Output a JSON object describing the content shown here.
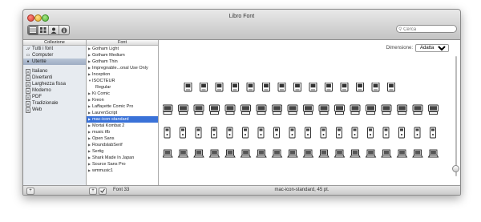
{
  "window": {
    "title": "Libro Font"
  },
  "search": {
    "placeholder": "Cerca"
  },
  "collections": {
    "header": "Collezione",
    "items": [
      {
        "label": "Tutti i font",
        "icon": "font-book-icon",
        "selected": false
      },
      {
        "label": "Computer",
        "icon": "computer-icon",
        "selected": false
      },
      {
        "label": "Utente",
        "icon": "user-icon",
        "selected": true
      },
      {
        "label": "Italiano",
        "icon": "font-collection-icon",
        "selected": false
      },
      {
        "label": "Divertenti",
        "icon": "font-collection-icon",
        "selected": false
      },
      {
        "label": "Larghezza fissa",
        "icon": "font-collection-icon",
        "selected": false
      },
      {
        "label": "Moderno",
        "icon": "font-collection-icon",
        "selected": false
      },
      {
        "label": "PDF",
        "icon": "font-collection-icon",
        "selected": false
      },
      {
        "label": "Tradizionale",
        "icon": "font-collection-icon",
        "selected": false
      },
      {
        "label": "Web",
        "icon": "font-collection-icon",
        "selected": false
      }
    ]
  },
  "fonts": {
    "header": "Font",
    "items": [
      {
        "label": "Gotham Light",
        "expanded": false,
        "selected": false,
        "sub": false
      },
      {
        "label": "Gotham Medium",
        "expanded": false,
        "selected": false,
        "sub": false
      },
      {
        "label": "Gotham Thin",
        "expanded": false,
        "selected": false,
        "sub": false
      },
      {
        "label": "Impregnable...onal Use Only",
        "expanded": false,
        "selected": false,
        "sub": false
      },
      {
        "label": "Inception",
        "expanded": false,
        "selected": false,
        "sub": false
      },
      {
        "label": "ISOCTEUR",
        "expanded": true,
        "selected": false,
        "sub": false
      },
      {
        "label": "Regular",
        "expanded": false,
        "selected": false,
        "sub": true
      },
      {
        "label": "Ki Comic",
        "expanded": false,
        "selected": false,
        "sub": false
      },
      {
        "label": "Kreon",
        "expanded": false,
        "selected": false,
        "sub": false
      },
      {
        "label": "Laffayette Comic Pro",
        "expanded": false,
        "selected": false,
        "sub": false
      },
      {
        "label": "LaurenScript",
        "expanded": false,
        "selected": false,
        "sub": false
      },
      {
        "label": "mac-icon-standard",
        "expanded": false,
        "selected": true,
        "sub": false
      },
      {
        "label": "Mortal Kombat 2",
        "expanded": false,
        "selected": false,
        "sub": false
      },
      {
        "label": "music tfb",
        "expanded": false,
        "selected": false,
        "sub": false
      },
      {
        "label": "Open Sans",
        "expanded": false,
        "selected": false,
        "sub": false
      },
      {
        "label": "RoundslabSerif",
        "expanded": false,
        "selected": false,
        "sub": false
      },
      {
        "label": "Sertig",
        "expanded": false,
        "selected": false,
        "sub": false
      },
      {
        "label": "Shark Made In Japan",
        "expanded": false,
        "selected": false,
        "sub": false
      },
      {
        "label": "Source Sans Pro",
        "expanded": false,
        "selected": false,
        "sub": false
      },
      {
        "label": "wmmusic1",
        "expanded": false,
        "selected": false,
        "sub": false
      }
    ]
  },
  "preview": {
    "size_label": "Dimensione:",
    "size_value": "Adatta",
    "size_options": [
      "Adatta"
    ],
    "glyph_rows": [
      [
        "compact-mac",
        "compact-mac",
        "compact-mac",
        "compact-mac",
        "compact-mac",
        "compact-mac",
        "compact-mac",
        "compact-mac",
        "compact-mac",
        "compact-mac",
        "compact-mac",
        "compact-mac",
        "compact-mac",
        "compact-mac"
      ],
      [
        "desktop-mac",
        "desktop-mac",
        "desktop-mac",
        "desktop-mac",
        "desktop-mac",
        "desktop-mac",
        "desktop-mac",
        "desktop-mac",
        "desktop-mac",
        "desktop-mac",
        "desktop-mac",
        "desktop-mac",
        "desktop-mac",
        "desktop-mac",
        "desktop-mac",
        "desktop-mac",
        "desktop-mac",
        "desktop-mac"
      ],
      [
        "tower-mac",
        "tower-mac",
        "tower-mac",
        "tower-mac",
        "tower-mac",
        "tower-mac",
        "tower-mac",
        "tower-mac",
        "tower-mac",
        "tower-mac",
        "tower-mac",
        "tower-mac",
        "tower-mac",
        "tower-mac",
        "tower-mac",
        "tower-mac",
        "tower-mac",
        "tower-mac"
      ],
      [
        "laptop-mac",
        "laptop-mac",
        "laptop-mac",
        "laptop-mac",
        "laptop-mac",
        "laptop-mac",
        "laptop-mac",
        "laptop-mac",
        "laptop-mac",
        "laptop-mac",
        "laptop-mac",
        "laptop-mac",
        "laptop-mac",
        "laptop-mac",
        "laptop-mac",
        "laptop-mac",
        "laptop-mac",
        "laptop-mac"
      ]
    ]
  },
  "footer": {
    "font_count": "Font 33",
    "status": "mac-icon-standard, 45 pt."
  },
  "colors": {
    "selection": "#3a72d8",
    "sidebar": "#e7ebf0"
  }
}
